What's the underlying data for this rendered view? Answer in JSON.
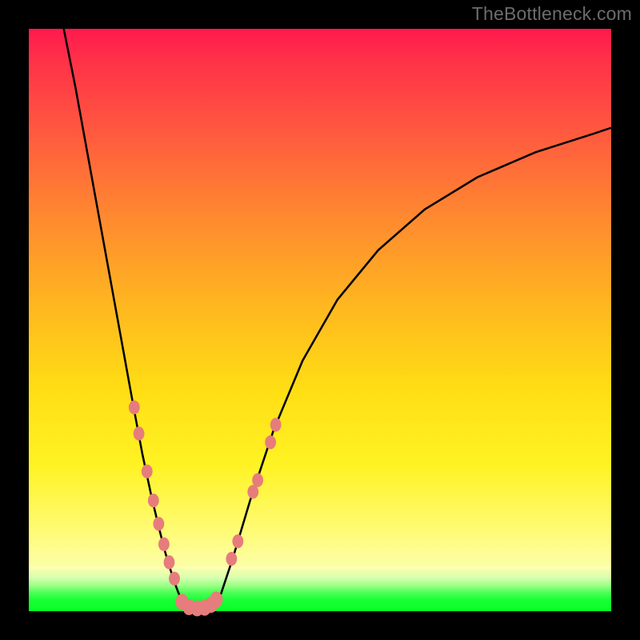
{
  "watermark": "TheBottleneck.com",
  "chart_data": {
    "type": "line",
    "title": "",
    "xlabel": "",
    "ylabel": "",
    "xlim": [
      0,
      100
    ],
    "ylim": [
      0,
      100
    ],
    "grid": false,
    "legend": false,
    "curve_left": {
      "comment": "steep left branch of the V, from top-left down to the valley floor",
      "x": [
        6,
        8,
        10,
        12,
        14,
        16,
        18,
        19.5,
        21,
        22.3,
        23.4,
        24.3,
        25.0,
        25.6,
        26.1,
        26.5,
        26.9,
        27.2
      ],
      "y": [
        100,
        90,
        79,
        68,
        57,
        46,
        35,
        27,
        20,
        14.5,
        10.2,
        7.2,
        5.0,
        3.4,
        2.2,
        1.4,
        0.8,
        0.4
      ]
    },
    "curve_floor": {
      "comment": "short flat segment at the bottom of the V",
      "x": [
        27.2,
        28.5,
        30.0,
        31.5
      ],
      "y": [
        0.4,
        0.2,
        0.2,
        0.5
      ]
    },
    "curve_right": {
      "comment": "right branch of the V, rising and flattening toward the right edge",
      "x": [
        31.5,
        33,
        35,
        38,
        42,
        47,
        53,
        60,
        68,
        77,
        87,
        97,
        100
      ],
      "y": [
        0.5,
        3,
        9,
        19,
        31,
        43,
        53.5,
        62,
        69,
        74.5,
        78.8,
        82,
        83
      ]
    },
    "dots_left_branch": {
      "comment": "salmon dots along the lower part of the left branch",
      "points": [
        {
          "x": 18.1,
          "y": 35.0
        },
        {
          "x": 18.9,
          "y": 30.5
        },
        {
          "x": 20.3,
          "y": 24.0
        },
        {
          "x": 21.4,
          "y": 19.0
        },
        {
          "x": 22.3,
          "y": 15.0
        },
        {
          "x": 23.2,
          "y": 11.5
        },
        {
          "x": 24.1,
          "y": 8.4
        },
        {
          "x": 25.0,
          "y": 5.6
        }
      ]
    },
    "dots_right_branch": {
      "comment": "salmon dots along the lower part of the right branch",
      "points": [
        {
          "x": 34.8,
          "y": 9.0
        },
        {
          "x": 35.9,
          "y": 12.0
        },
        {
          "x": 38.5,
          "y": 20.5
        },
        {
          "x": 39.3,
          "y": 22.5
        },
        {
          "x": 41.5,
          "y": 29.0
        },
        {
          "x": 42.4,
          "y": 32.0
        }
      ]
    },
    "dots_valley": {
      "comment": "connected lobed cluster of salmon dots sitting on the green floor at the valley",
      "points": [
        {
          "x": 26.3,
          "y": 1.6
        },
        {
          "x": 27.5,
          "y": 0.7
        },
        {
          "x": 28.9,
          "y": 0.5
        },
        {
          "x": 30.2,
          "y": 0.6
        },
        {
          "x": 31.3,
          "y": 1.1
        },
        {
          "x": 32.2,
          "y": 2.0
        }
      ]
    },
    "gradient_stops": [
      {
        "pos": 0.0,
        "color": "#ff1a4d"
      },
      {
        "pos": 0.18,
        "color": "#ff5a3f"
      },
      {
        "pos": 0.48,
        "color": "#ffb81f"
      },
      {
        "pos": 0.75,
        "color": "#fff324"
      },
      {
        "pos": 0.93,
        "color": "#fcffa8"
      },
      {
        "pos": 0.96,
        "color": "#9cff86"
      },
      {
        "pos": 1.0,
        "color": "#06ff24"
      }
    ],
    "dot_color": "#e77c7c",
    "curve_color": "#000000"
  }
}
